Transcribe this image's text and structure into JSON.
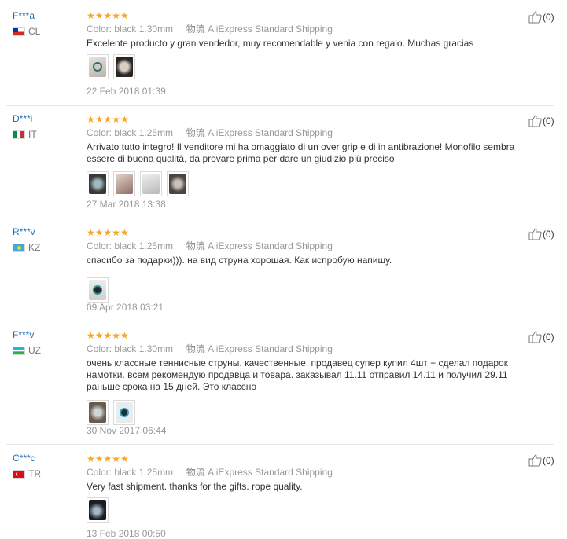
{
  "reviews": [
    {
      "user": "F***a",
      "country": "CL",
      "rating": "★★★★★",
      "color_label": "Color:",
      "color_value": "black 1.30mm",
      "ship_label": "物流",
      "ship_value": "AliExpress Standard Shipping",
      "text": "Excelente producto y gran vendedor, muy recomendable y venia con regalo. Muchas gracias",
      "photos": 2,
      "date": "22 Feb 2018 01:39",
      "useful": "(0)"
    },
    {
      "user": "D***i",
      "country": "IT",
      "rating": "★★★★★",
      "color_label": "Color:",
      "color_value": "black 1.25mm",
      "ship_label": "物流",
      "ship_value": "AliExpress Standard Shipping",
      "text": "Arrivato tutto integro! Il venditore mi ha omaggiato di un over grip e di in antibrazione! Monofilo sembra essere di buona qualità, da provare prima per dare un giudizio più preciso",
      "photos": 4,
      "date": "27 Mar 2018 13:38",
      "useful": "(0)"
    },
    {
      "user": "R***v",
      "country": "KZ",
      "rating": "★★★★★",
      "color_label": "Color:",
      "color_value": "black 1.25mm",
      "ship_label": "物流",
      "ship_value": "AliExpress Standard Shipping",
      "text": "спасибо за подарки))). на вид струна хорошая. Как испробую напишу.",
      "photos": 1,
      "date": "09 Apr 2018 03:21",
      "useful": "(0)"
    },
    {
      "user": "F***v",
      "country": "UZ",
      "rating": "★★★★★",
      "color_label": "Color:",
      "color_value": "black 1.30mm",
      "ship_label": "物流",
      "ship_value": "AliExpress Standard Shipping",
      "text": "очень классные теннисные струны. качественные, продавец супер купил 4шт + сделал подарок намотки. всем рекомендую продавца и товара. заказывал 11.11 отправил 14.11 и получил 29.11 раньше срока на 15 дней. Это классно",
      "photos": 2,
      "date": "30 Nov 2017 06:44",
      "useful": "(0)"
    },
    {
      "user": "C***c",
      "country": "TR",
      "rating": "★★★★★",
      "color_label": "Color:",
      "color_value": "black 1.25mm",
      "ship_label": "物流",
      "ship_value": "AliExpress Standard Shipping",
      "text": "Very fast shipment. thanks for the gifts. rope quality.",
      "photos": 1,
      "date": "13 Feb 2018 00:50",
      "useful": "(0)"
    }
  ],
  "colors": {
    "username": "#1f6fb5",
    "star": "#f6a623",
    "meta": "#999999"
  }
}
